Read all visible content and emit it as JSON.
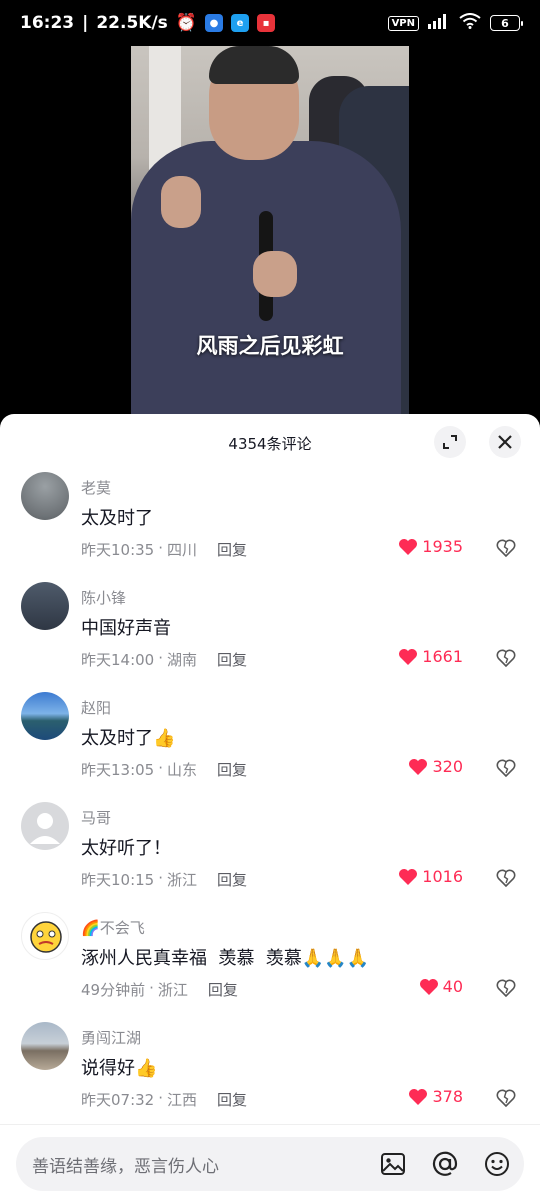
{
  "status_bar": {
    "time": "16:23",
    "speed": "22.5K/s",
    "vpn": "VPN",
    "battery": "6"
  },
  "video": {
    "subtitle": "风雨之后见彩虹"
  },
  "comments_panel": {
    "count_label": "4354条评论",
    "comments": [
      {
        "name": "老莫",
        "text": "太及时了",
        "time": "昨天10:35",
        "location": "四川",
        "reply": "回复",
        "likes": "1935",
        "avatar": "gray-sky"
      },
      {
        "name": "陈小锋",
        "text": "中国好声音",
        "time": "昨天14:00",
        "location": "湖南",
        "reply": "回复",
        "likes": "1661",
        "avatar": "man-photo"
      },
      {
        "name": "赵阳",
        "text": "太及时了",
        "emoji": "👍",
        "time": "昨天13:05",
        "location": "山东",
        "reply": "回复",
        "likes": "320",
        "avatar": "lake-photo"
      },
      {
        "name": "马哥",
        "text": "太好听了！",
        "time": "昨天10:15",
        "location": "浙江",
        "reply": "回复",
        "likes": "1016",
        "avatar": "default"
      },
      {
        "name": "不会飞",
        "name_prefix": "🌈",
        "text": "涿州人民真幸福  羡慕  羡慕",
        "emoji": "🙏🙏🙏",
        "time": "49分钟前",
        "location": "浙江",
        "reply": "回复",
        "likes": "40",
        "avatar": "emoji-face"
      },
      {
        "name": "勇闯江湖",
        "text": "说得好",
        "emoji": "👍",
        "time": "昨天07:32",
        "location": "江西",
        "reply": "回复",
        "likes": "378",
        "avatar": "plaza-photo"
      }
    ]
  },
  "input": {
    "placeholder": "善语结善缘，恶言伤人心"
  },
  "colors": {
    "like": "#fe2c55",
    "meta": "#8a8b91",
    "text": "#161823"
  }
}
